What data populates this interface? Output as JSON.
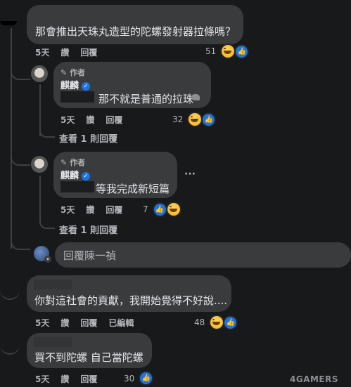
{
  "comments": [
    {
      "text": "那會推出天珠丸造型的陀螺發射器拉條嗎？",
      "time": "5天",
      "like": "讚",
      "reply": "回覆",
      "count": "51",
      "reactions": [
        "haha",
        "like"
      ]
    },
    {
      "text": "你對這社會的貢獻，我開始覺得不好說....",
      "time": "5天",
      "like": "讚",
      "reply": "回覆",
      "edited": "已編輯",
      "count": "48",
      "reactions": [
        "haha",
        "like"
      ]
    },
    {
      "text": "買不到陀螺 自己當陀螺",
      "time": "5天",
      "like": "讚",
      "reply": "回覆",
      "count": "30",
      "reactions": [
        "like"
      ]
    }
  ],
  "replies": [
    {
      "badge": "作者",
      "name": "麒麟",
      "text": "那不就是普通的拉珠",
      "time": "5天",
      "like": "讚",
      "reply": "回覆",
      "count": "32",
      "reactions": [
        "haha",
        "like"
      ],
      "view_more": "查看 1 則回覆"
    },
    {
      "badge": "作者",
      "name": "麒麟",
      "text": "等我完成新短篇",
      "time": "5天",
      "like": "讚",
      "reply": "回覆",
      "count": "7",
      "reactions": [
        "like",
        "haha"
      ],
      "view_more": "查看 1 則回覆",
      "more": "···"
    }
  ],
  "reply_input": {
    "placeholder": "回覆陳一禎"
  },
  "watermark": "4GAMERS",
  "colors": {
    "background": "#18191a",
    "bubble": "#3a3b3c",
    "like_blue": "#1b74e4",
    "haha_yellow": "#f7b125"
  }
}
